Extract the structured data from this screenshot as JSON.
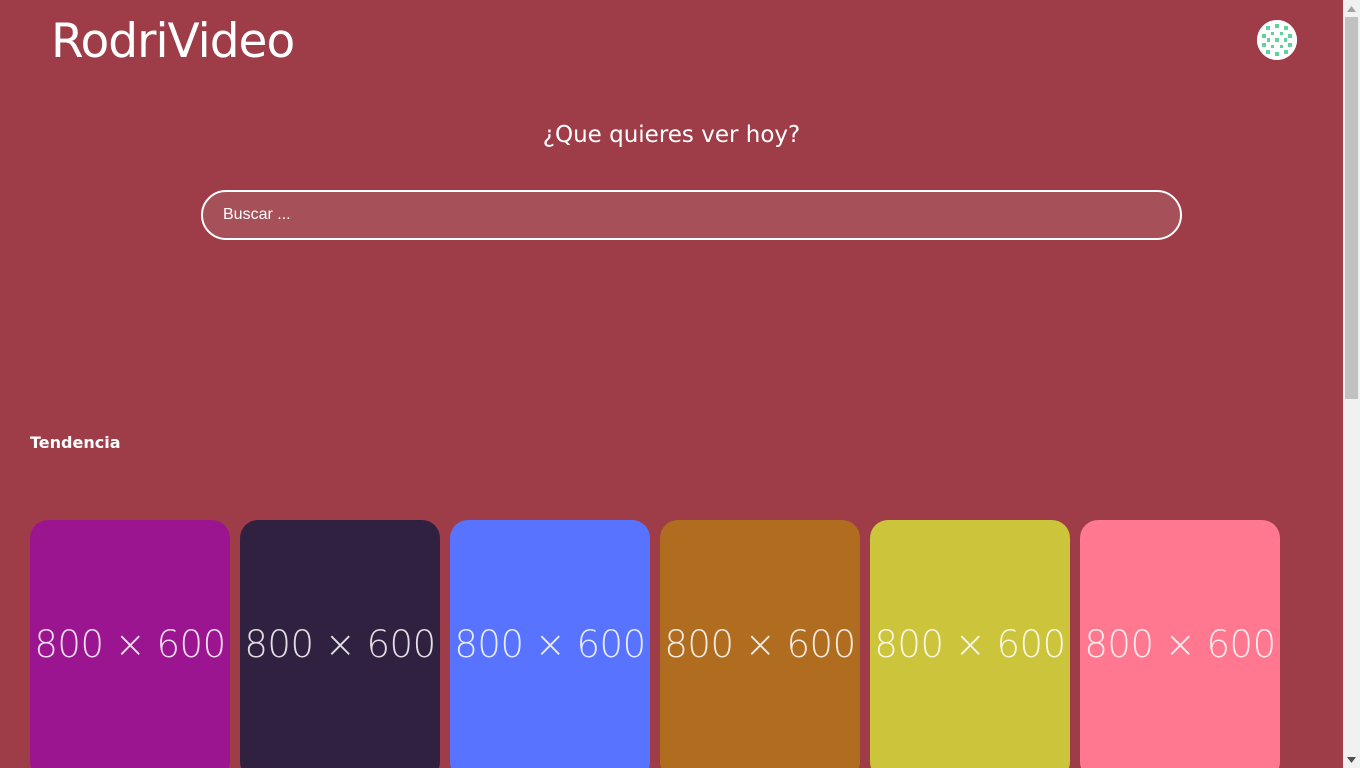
{
  "header": {
    "logo_text": "RodriVideo",
    "avatar_icon": "identicon-avatar"
  },
  "hero": {
    "headline": "¿Que quieres ver hoy?",
    "search_placeholder": "Buscar ..."
  },
  "trending": {
    "title": "Tendencia",
    "cards": [
      {
        "label": "800 × 600",
        "color": "#9c1590"
      },
      {
        "label": "800 × 600",
        "color": "#312141"
      },
      {
        "label": "800 × 600",
        "color": "#5773ff"
      },
      {
        "label": "800 × 600",
        "color": "#b06d20"
      },
      {
        "label": "800 × 600",
        "color": "#ccc43a"
      },
      {
        "label": "800 × 600",
        "color": "#ff7890"
      }
    ]
  },
  "colors": {
    "background": "#9e3d48",
    "search_background": "#a65059",
    "text": "#ffffff"
  }
}
